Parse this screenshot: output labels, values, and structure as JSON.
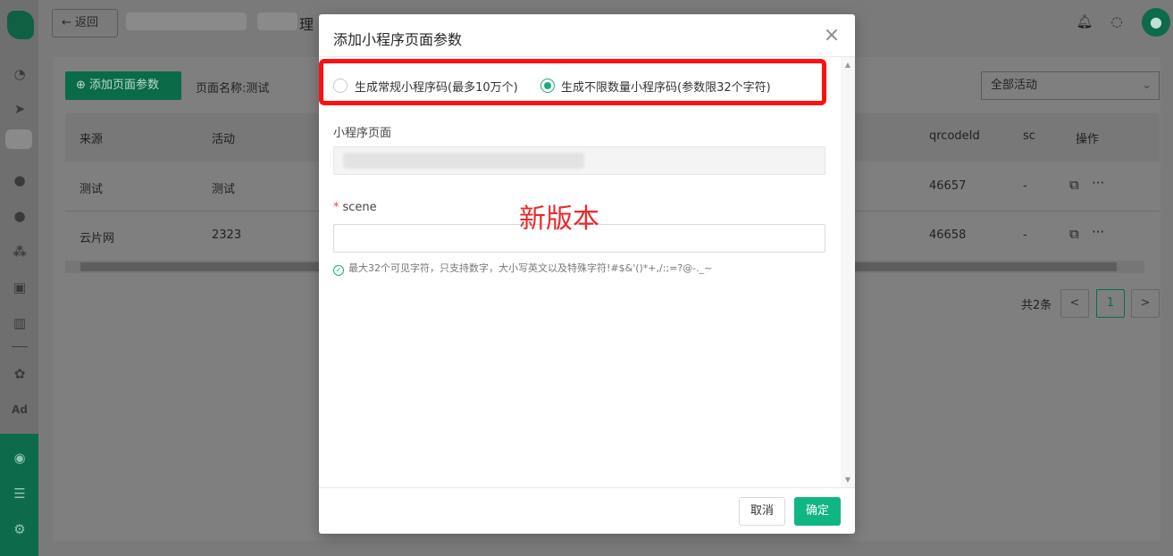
{
  "topbar": {
    "back_label": "返回",
    "title_suffix": "理",
    "icons": [
      "bell-icon",
      "chat-icon",
      "user-icon"
    ]
  },
  "page": {
    "add_button": "添加页面参数",
    "page_name": "页面名称:测试",
    "activity_select": "全部活动"
  },
  "table": {
    "columns": [
      "来源",
      "活动",
      "qrcodeId",
      "sc",
      "操作"
    ],
    "rows": [
      {
        "source": "测试",
        "activity": "测试",
        "qrcodeId": "46657",
        "sc": "-"
      },
      {
        "source": "云片网",
        "activity": "2323",
        "qrcodeId": "46658",
        "sc": "-"
      }
    ]
  },
  "pagination": {
    "total": "共2条",
    "prev": "<",
    "current": "1",
    "next": ">"
  },
  "modal": {
    "title": "添加小程序页面参数",
    "radio_option_1": "生成常规小程序码(最多10万个)",
    "radio_option_2": "生成不限数量小程序码(参数限32个字符)",
    "selected_option": 2,
    "mini_page_label": "小程序页面",
    "scene_label": "scene",
    "scene_value": "",
    "hint": "最大32个可见字符，只支持数字，大小写英文以及特殊字符!#$&'()*+,/:;=?@-._~",
    "annotation": "新版本",
    "cancel": "取消",
    "ok": "确定"
  },
  "colors": {
    "primary": "#10b584",
    "highlight": "#ff1010",
    "annotation": "#e82a2a"
  }
}
